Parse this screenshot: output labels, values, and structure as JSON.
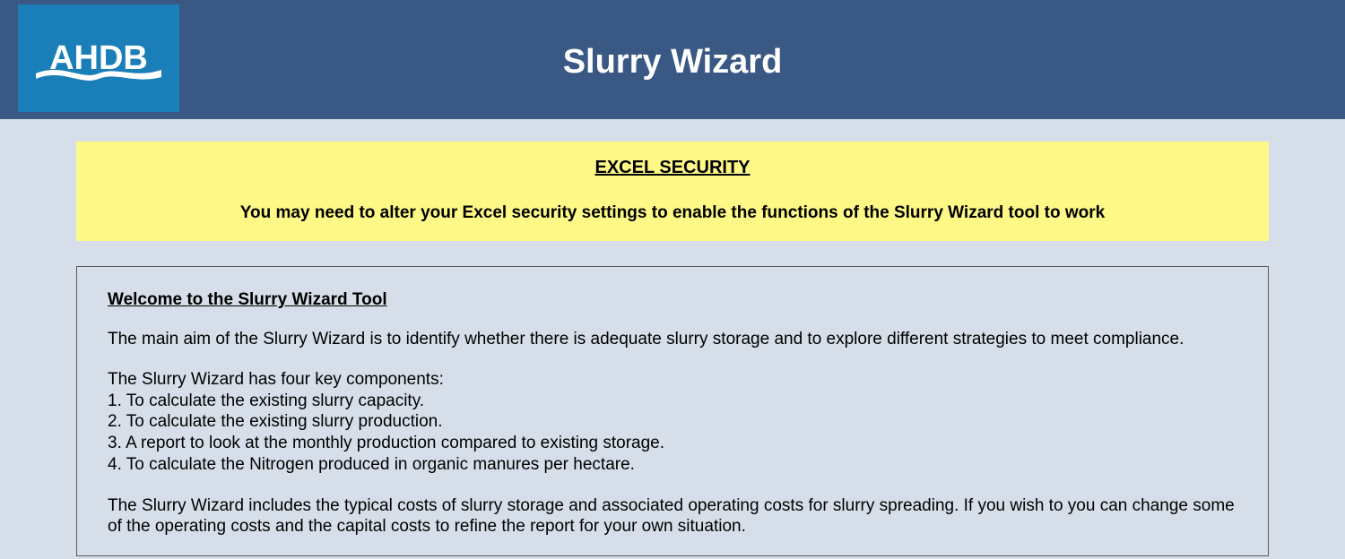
{
  "header": {
    "logo_text": "AHDB",
    "title": "Slurry Wizard"
  },
  "security_banner": {
    "heading": "EXCEL SECURITY",
    "text": "You may need to alter your Excel security settings to enable the functions of the Slurry Wizard tool to work"
  },
  "welcome": {
    "heading": "Welcome to the Slurry Wizard Tool",
    "main_aim": "The main aim of the Slurry Wizard is to identify whether there is adequate slurry storage and to explore different strategies to meet compliance.",
    "components_intro": "The Slurry Wizard has four key components:",
    "components": [
      "1. To calculate the existing slurry capacity.",
      "2. To calculate the existing slurry production.",
      "3. A report to look at the monthly production compared to existing storage.",
      "4. To calculate the Nitrogen produced in organic manures per hectare."
    ],
    "costs_paragraph": "The Slurry Wizard includes the typical costs of slurry storage and associated operating costs for slurry spreading. If you wish to you can change some of the operating costs and the capital costs to refine the report for your own situation."
  }
}
